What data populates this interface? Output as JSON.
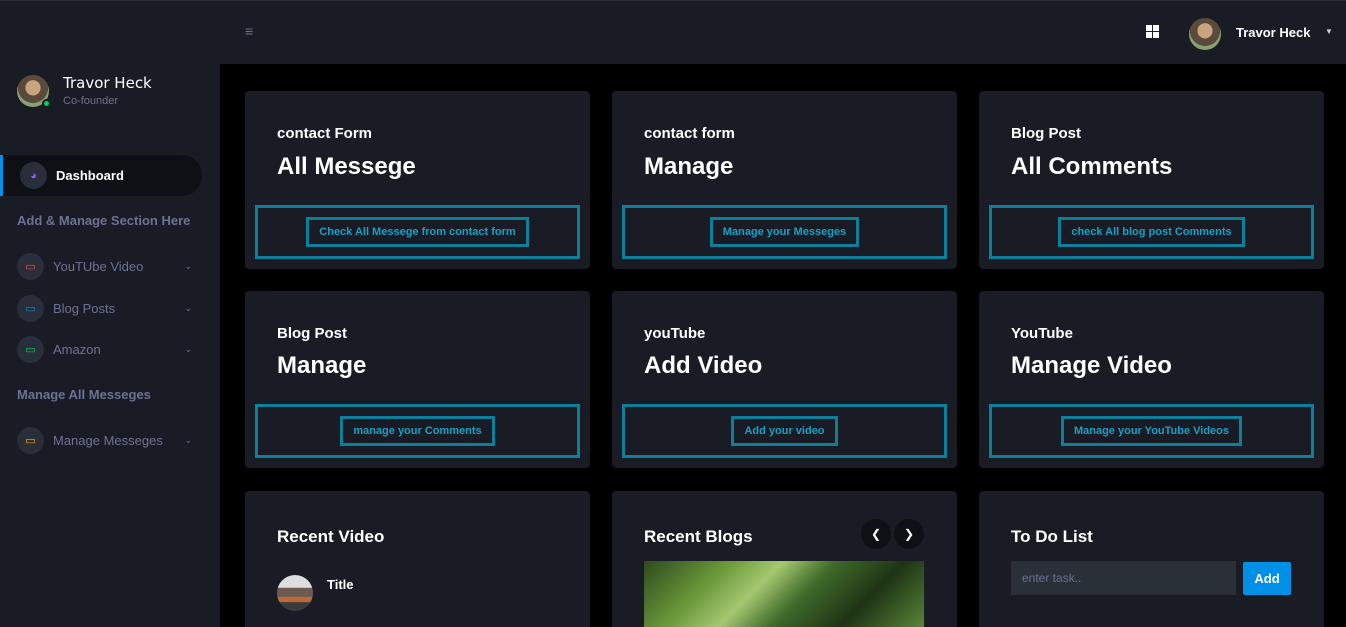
{
  "sidebar": {
    "profile": {
      "name": "Travor Heck",
      "role": "Co-founder"
    },
    "dashboard": {
      "label": "Dashboard",
      "icon": "speedometer-icon"
    },
    "section1": "Add & Manage Section Here",
    "items": [
      {
        "label": "YouTUbe Video",
        "icon": "laptop-icon",
        "color": "#fc424a"
      },
      {
        "label": "Blog Posts",
        "icon": "laptop-icon",
        "color": "#0090e7"
      },
      {
        "label": "Amazon",
        "icon": "laptop-icon",
        "color": "#00d25b"
      }
    ],
    "section2": "Manage All Messeges",
    "items2": [
      {
        "label": "Manage Messeges",
        "icon": "laptop-icon",
        "color": "#ffab00"
      }
    ]
  },
  "topbar": {
    "user_name": "Travor Heck"
  },
  "cards": [
    {
      "sub": "contact Form",
      "title": "All Messege",
      "button": "Check All Messege from contact form"
    },
    {
      "sub": "contact form",
      "title": "Manage",
      "button": "Manage your Messeges"
    },
    {
      "sub": "Blog Post",
      "title": "All Comments",
      "button": "check All blog post Comments"
    },
    {
      "sub": "Blog Post",
      "title": "Manage",
      "button": "manage your Comments"
    },
    {
      "sub": "youTube",
      "title": "Add Video",
      "button": "Add your video"
    },
    {
      "sub": "YouTube",
      "title": "Manage Video",
      "button": "Manage your YouTube Videos"
    }
  ],
  "recent_video": {
    "heading": "Recent Video",
    "item_title": "Title"
  },
  "recent_blogs": {
    "heading": "Recent Blogs"
  },
  "todo": {
    "heading": "To Do List",
    "placeholder": "enter task..",
    "add_label": "Add"
  },
  "colors": {
    "accent": "#0c7f9b",
    "primary": "#0090e7",
    "bg_card": "#191c24"
  }
}
